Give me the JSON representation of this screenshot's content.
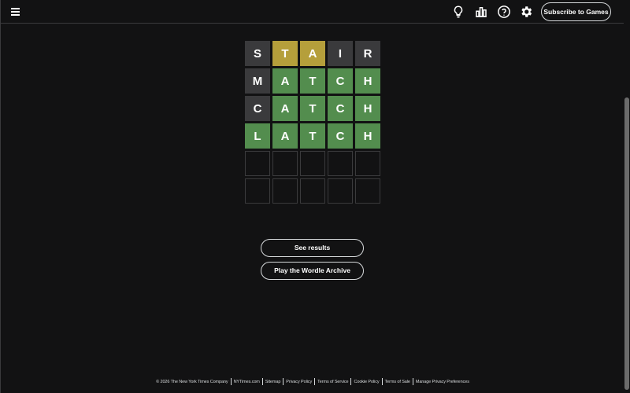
{
  "header": {
    "menu_icon": "hamburger-menu-icon",
    "icons": [
      "hint-lightbulb-icon",
      "stats-bar-chart-icon",
      "help-question-icon",
      "settings-gear-icon"
    ],
    "subscribe_label": "Subscribe to Games"
  },
  "board": {
    "rows": [
      {
        "letters": [
          "S",
          "T",
          "A",
          "I",
          "R"
        ],
        "states": [
          "absent",
          "present",
          "present",
          "absent",
          "absent"
        ]
      },
      {
        "letters": [
          "M",
          "A",
          "T",
          "C",
          "H"
        ],
        "states": [
          "absent",
          "correct",
          "correct",
          "correct",
          "correct"
        ]
      },
      {
        "letters": [
          "C",
          "A",
          "T",
          "C",
          "H"
        ],
        "states": [
          "absent",
          "correct",
          "correct",
          "correct",
          "correct"
        ]
      },
      {
        "letters": [
          "L",
          "A",
          "T",
          "C",
          "H"
        ],
        "states": [
          "correct",
          "correct",
          "correct",
          "correct",
          "correct"
        ]
      },
      {
        "letters": [
          "",
          "",
          "",
          "",
          ""
        ],
        "states": [
          "empty",
          "empty",
          "empty",
          "empty",
          "empty"
        ]
      },
      {
        "letters": [
          "",
          "",
          "",
          "",
          ""
        ],
        "states": [
          "empty",
          "empty",
          "empty",
          "empty",
          "empty"
        ]
      }
    ],
    "colors": {
      "absent": "#3a3a3c",
      "present": "#b59f3b",
      "correct": "#538d4e"
    }
  },
  "actions": {
    "see_results_label": "See results",
    "archive_label": "Play the Wordle Archive"
  },
  "footer": {
    "copyright": "© 2026 The New York Times Company",
    "links": [
      "NYTimes.com",
      "Sitemap",
      "Privacy Policy",
      "Terms of Service",
      "Cookie Policy",
      "Terms of Sale",
      "Manage Privacy Preferences"
    ]
  }
}
